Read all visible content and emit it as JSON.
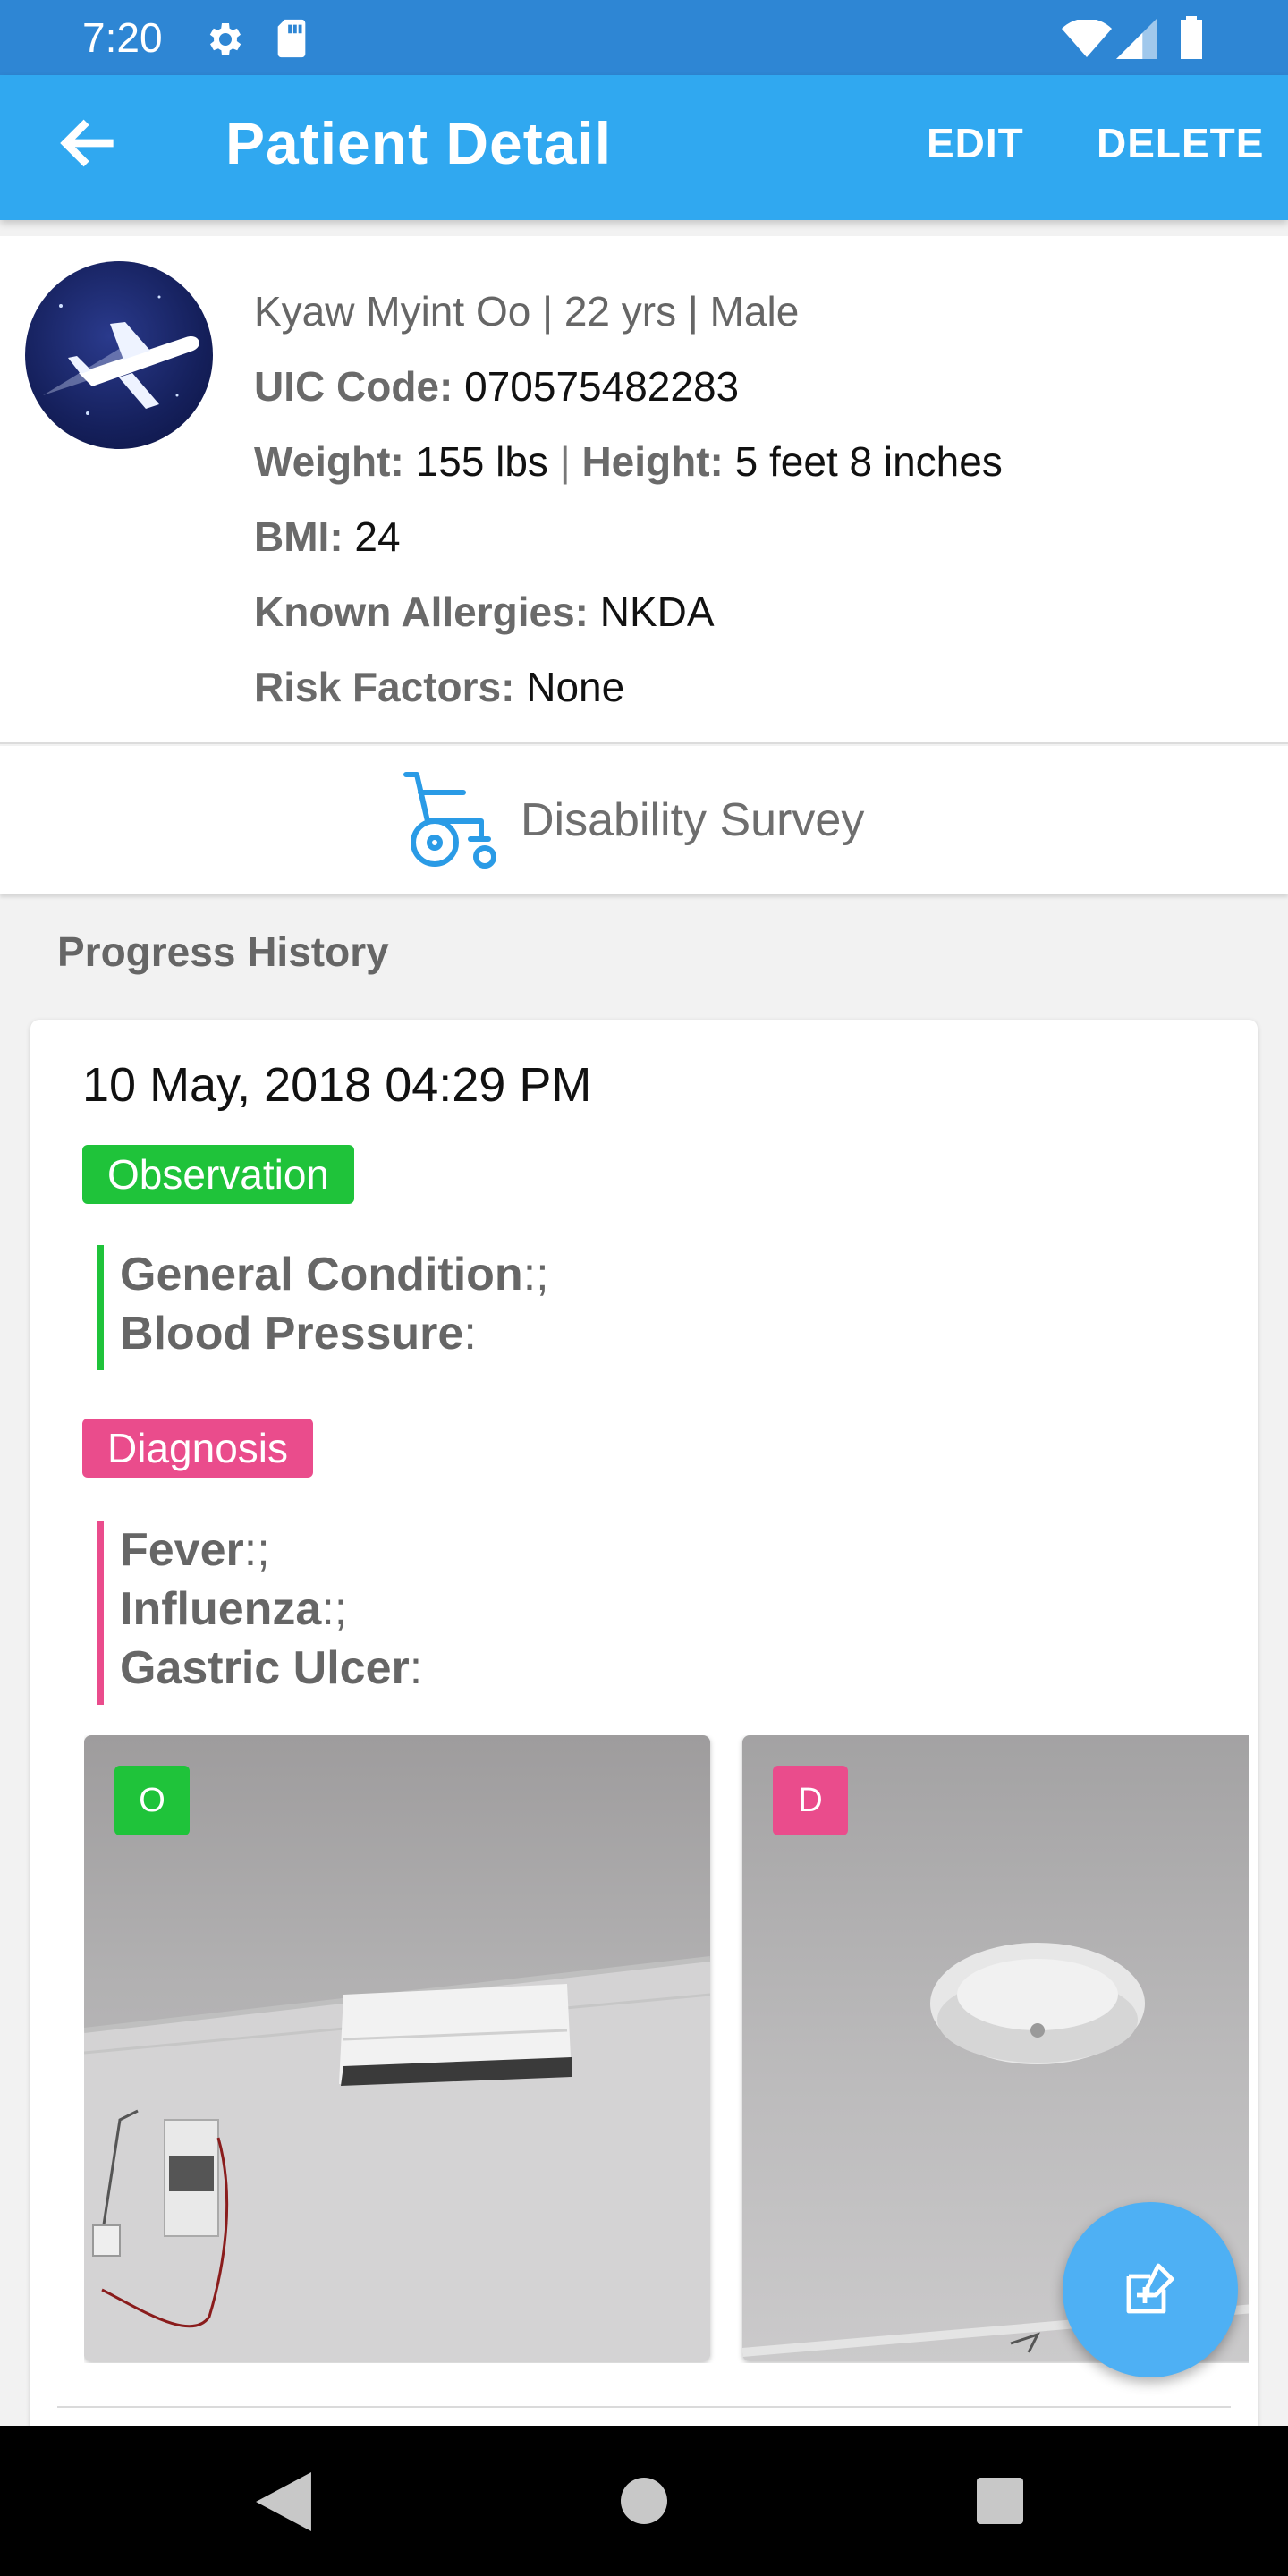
{
  "status_bar": {
    "time": "7:20",
    "icons": [
      "gear-icon",
      "sd-card-icon",
      "wifi-icon",
      "signal-icon",
      "battery-icon"
    ]
  },
  "app_bar": {
    "title": "Patient Detail",
    "edit_label": "EDIT",
    "delete_label": "DELETE",
    "color": "#30a8f0"
  },
  "patient": {
    "summary": "Kyaw Myint Oo | 22 yrs | Male",
    "uic_label": "UIC Code:",
    "uic_value": "070575482283",
    "weight_label": "Weight:",
    "weight_value": "155 lbs",
    "separator": "|",
    "height_label": "Height:",
    "height_value": "5 feet 8 inches",
    "bmi_label": "BMI:",
    "bmi_value": "24",
    "allergies_label": "Known Allergies:",
    "allergies_value": "NKDA",
    "risk_label": "Risk Factors:",
    "risk_value": "None"
  },
  "disability_survey": {
    "label": "Disability Survey",
    "icon": "wheelchair-icon"
  },
  "progress_history": {
    "title": "Progress History",
    "entries": [
      {
        "date": "10 May, 2018 04:29 PM",
        "observation": {
          "badge": "Observation",
          "color": "#1fc33a",
          "items": [
            {
              "name": "General Condition",
              "suffix": ":;"
            },
            {
              "name": "Blood Pressure",
              "suffix": ":"
            }
          ]
        },
        "diagnosis": {
          "badge": "Diagnosis",
          "color": "#ea4c8c",
          "items": [
            {
              "name": "Fever",
              "suffix": ":;"
            },
            {
              "name": "Influenza",
              "suffix": ":;"
            },
            {
              "name": "Gastric Ulcer",
              "suffix": ":"
            }
          ]
        },
        "photos": [
          {
            "tag": "O"
          },
          {
            "tag": "D"
          }
        ]
      }
    ]
  },
  "fab": {
    "icon": "add-note-icon"
  }
}
